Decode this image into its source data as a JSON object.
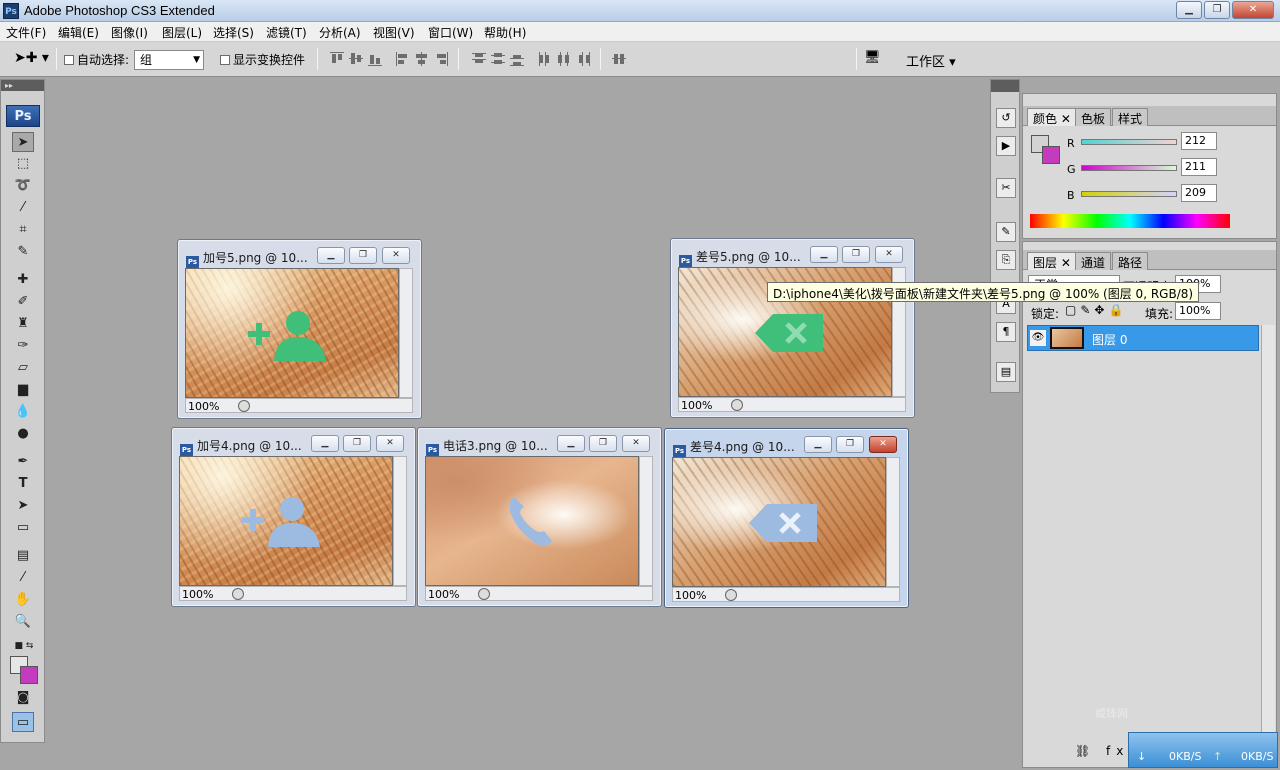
{
  "titlebar": {
    "icon": "Ps",
    "title": "Adobe Photoshop CS3 Extended",
    "buttons": [
      "minimize",
      "restore",
      "close"
    ]
  },
  "menubar": {
    "items": [
      "文件(F)",
      "编辑(E)",
      "图像(I)",
      "图层(L)",
      "选择(S)",
      "滤镜(T)",
      "分析(A)",
      "视图(V)",
      "窗口(W)",
      "帮助(H)"
    ]
  },
  "options": {
    "auto_select_label": "自动选择:",
    "auto_select_value": "组",
    "show_transform_label": "显示变换控件",
    "workspace_label": "工作区"
  },
  "toolbox": {
    "badge": "Ps",
    "type_tool": "T"
  },
  "documents": [
    {
      "title": "加号5.png @ 10...",
      "zoom": "100%"
    },
    {
      "title": "差号5.png @ 10...",
      "zoom": "100%"
    },
    {
      "title": "加号4.png @ 10...",
      "zoom": "100%"
    },
    {
      "title": "电话3.png @ 10...",
      "zoom": "100%"
    },
    {
      "title": "差号4.png @ 10...",
      "zoom": "100%"
    }
  ],
  "tooltip": "D:\\iphone4\\美化\\拨号面板\\新建文件夹\\差号5.png @ 100% (图层 0, RGB/8)",
  "color_panel": {
    "tabs": [
      "颜色",
      "色板",
      "样式"
    ],
    "r_label": "R",
    "r_value": "212",
    "g_label": "G",
    "g_value": "211",
    "b_label": "B",
    "b_value": "209"
  },
  "layers_panel": {
    "tabs": [
      "图层",
      "通道",
      "路径"
    ],
    "blend_mode": "正常",
    "opacity_label": "不透明度:",
    "opacity_value": "100%",
    "lock_label": "锁定:",
    "fill_label": "填充:",
    "fill_value": "100%",
    "layer_name": "图层 0"
  },
  "network": {
    "down": "0KB/S",
    "up": "0KB/S"
  },
  "watermark": "威锋网"
}
